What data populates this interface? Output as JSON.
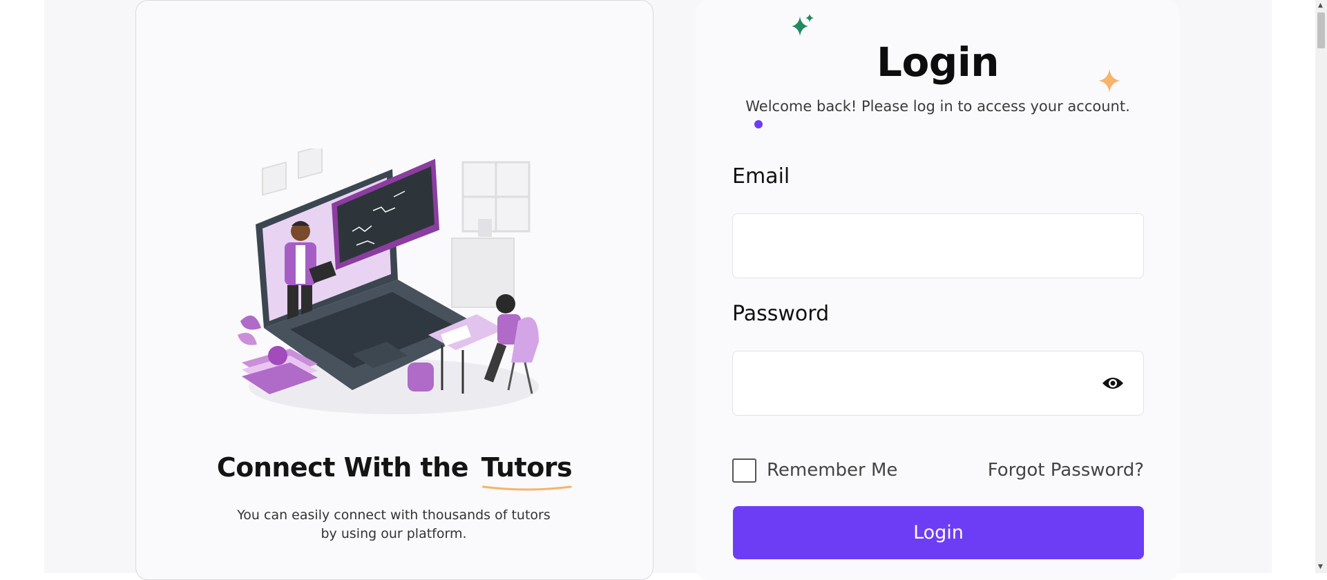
{
  "left_panel": {
    "title_prefix": "Connect With the",
    "title_highlight": "Tutors",
    "subtitle": "You can easily connect with thousands of tutors by using our platform.",
    "illustration": "online-tutoring-illustration",
    "highlight_underline_color": "#f5b46a"
  },
  "login": {
    "title": "Login",
    "welcome": "Welcome back! Please log in to access your account.",
    "email_label": "Email",
    "email_value": "",
    "password_label": "Password",
    "password_value": "",
    "remember_label": "Remember Me",
    "forgot_label": "Forgot Password?",
    "button_label": "Login"
  },
  "icons": {
    "sparkle_green": "sparkle-icon",
    "sparkle_orange": "star-icon",
    "eye": "eye-icon"
  },
  "colors": {
    "accent": "#6d3df5",
    "sparkle_green": "#1f8a5e",
    "sparkle_orange": "#f5b46a",
    "background": "#f7f7fa"
  }
}
